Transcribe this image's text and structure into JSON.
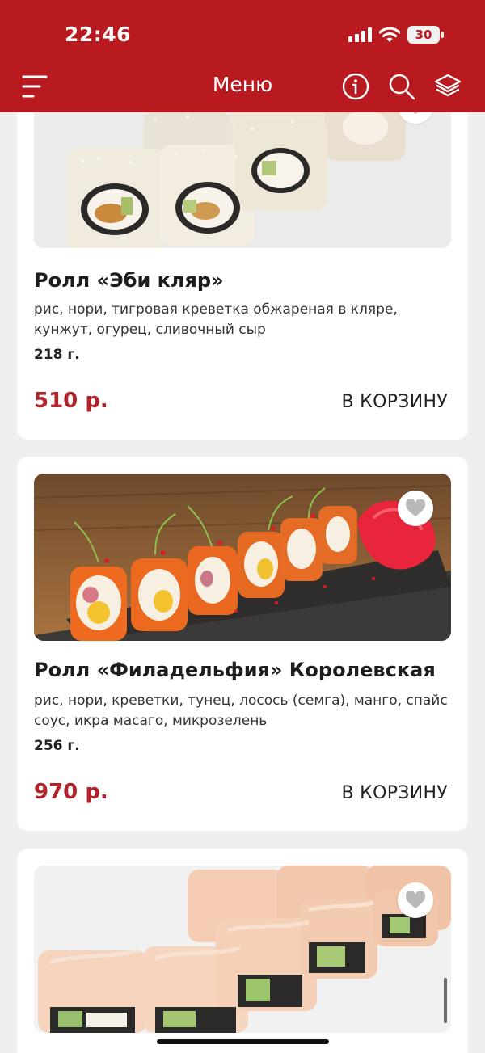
{
  "status": {
    "time": "22:46",
    "battery": "30"
  },
  "header": {
    "title": "Меню"
  },
  "products": [
    {
      "name": "Ролл «Эби кляр»",
      "description": "рис, нори, тигровая креветка обжареная в кляре, кунжут, огурец, сливочный сыр",
      "weight": "218 г.",
      "price": "510 р.",
      "cart_label": "В КОРЗИНУ"
    },
    {
      "name": "Ролл «Филадельфия» Королевская",
      "description": "рис, нори, креветки, тунец, лосось (семга), манго, спайс соус, икра масаго, микрозелень",
      "weight": "256 г.",
      "price": "970 р.",
      "cart_label": "В КОРЗИНУ"
    }
  ],
  "colors": {
    "brand": "#b91a1f",
    "price": "#b3232a"
  },
  "icons": [
    "menu-icon",
    "info-icon",
    "search-icon",
    "layers-icon",
    "heart-icon"
  ]
}
